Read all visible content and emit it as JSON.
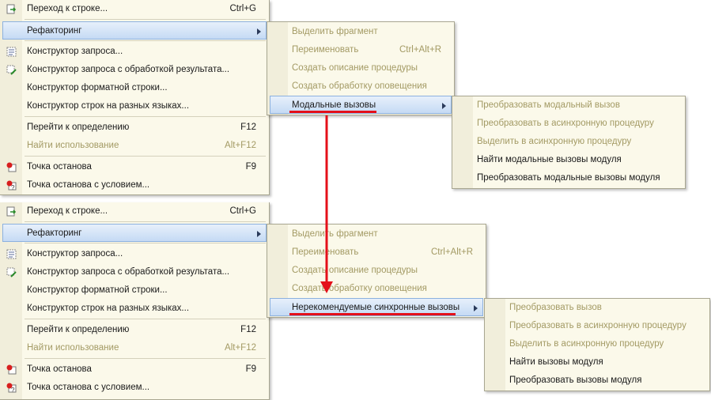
{
  "menu_top": {
    "items": [
      {
        "label": "Переход к строке...",
        "shortcut": "Ctrl+G",
        "icon": "goto-line-icon"
      },
      {
        "label": "Рефакторинг"
      },
      {
        "label": "Конструктор запроса...",
        "icon": "query-builder-icon"
      },
      {
        "label": "Конструктор запроса с обработкой результата...",
        "icon": "query-result-builder-icon"
      },
      {
        "label": "Конструктор форматной строки..."
      },
      {
        "label": "Конструктор строк на разных языках..."
      },
      {
        "label": "Перейти к определению",
        "shortcut": "F12"
      },
      {
        "label": "Найти использование",
        "shortcut": "Alt+F12"
      },
      {
        "label": "Точка останова",
        "shortcut": "F9",
        "icon": "breakpoint-icon"
      },
      {
        "label": "Точка останова с условием...",
        "icon": "conditional-breakpoint-icon"
      }
    ]
  },
  "refactor_top": {
    "items": [
      {
        "label": "Выделить фрагмент"
      },
      {
        "label": "Переименовать",
        "shortcut": "Ctrl+Alt+R"
      },
      {
        "label": "Создать описание процедуры"
      },
      {
        "label": "Создать обработку оповещения"
      },
      {
        "label": "Модальные вызовы"
      }
    ]
  },
  "modal_sub": {
    "items": [
      {
        "label": "Преобразовать модальный вызов"
      },
      {
        "label": "Преобразовать в асинхронную процедуру"
      },
      {
        "label": "Выделить в асинхронную процедуру"
      },
      {
        "label": "Найти модальные вызовы модуля"
      },
      {
        "label": "Преобразовать модальные вызовы модуля"
      }
    ]
  },
  "menu_bottom": {
    "items": [
      {
        "label": "Переход к строке...",
        "shortcut": "Ctrl+G"
      },
      {
        "label": "Рефакторинг"
      },
      {
        "label": "Конструктор запроса..."
      },
      {
        "label": "Конструктор запроса с обработкой результата..."
      },
      {
        "label": "Конструктор форматной строки..."
      },
      {
        "label": "Конструктор строк на разных языках..."
      },
      {
        "label": "Перейти к определению",
        "shortcut": "F12"
      },
      {
        "label": "Найти использование",
        "shortcut": "Alt+F12"
      },
      {
        "label": "Точка останова",
        "shortcut": "F9"
      },
      {
        "label": "Точка останова с условием..."
      }
    ]
  },
  "refactor_bottom": {
    "items": [
      {
        "label": "Выделить фрагмент"
      },
      {
        "label": "Переименовать",
        "shortcut": "Ctrl+Alt+R"
      },
      {
        "label": "Создать описание процедуры"
      },
      {
        "label": "Создать обработку оповещения"
      },
      {
        "label": "Нерекомендуемые синхронные вызовы"
      }
    ]
  },
  "sync_sub": {
    "items": [
      {
        "label": "Преобразовать вызов"
      },
      {
        "label": "Преобразовать в асинхронную процедуру"
      },
      {
        "label": "Выделить в асинхронную процедуру"
      },
      {
        "label": "Найти вызовы модуля"
      },
      {
        "label": "Преобразовать вызовы модуля"
      }
    ]
  },
  "colors": {
    "highlight_arrow": "#e4101a",
    "disabled_text": "#a39a64",
    "menu_bg": "#fbf9ea",
    "selected_bg": "#c5daf4"
  }
}
